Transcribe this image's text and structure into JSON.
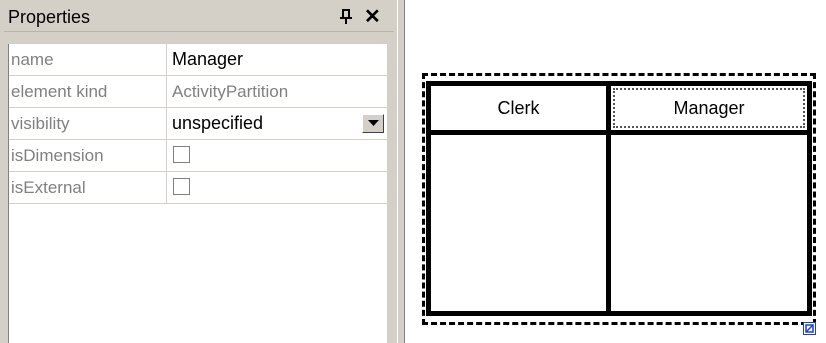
{
  "properties": {
    "title": "Properties",
    "pin_icon": "pin-icon",
    "close_icon": "close-icon",
    "close_glyph": "✕",
    "rows": [
      {
        "name": "name",
        "value": "Manager"
      },
      {
        "name": "element kind",
        "value": "ActivityPartition"
      },
      {
        "name": "visibility",
        "value": "unspecified"
      },
      {
        "name": "isDimension",
        "checked": false
      },
      {
        "name": "isExternal",
        "checked": false
      }
    ]
  },
  "diagram": {
    "partitions": [
      {
        "label": "Clerk"
      },
      {
        "label": "Manager",
        "selected": true
      }
    ]
  },
  "colors": {
    "panel_bg": "#d4d0c8",
    "label_grey": "#808080",
    "line": "#000000",
    "handle_blue": "#1a3fd6"
  }
}
